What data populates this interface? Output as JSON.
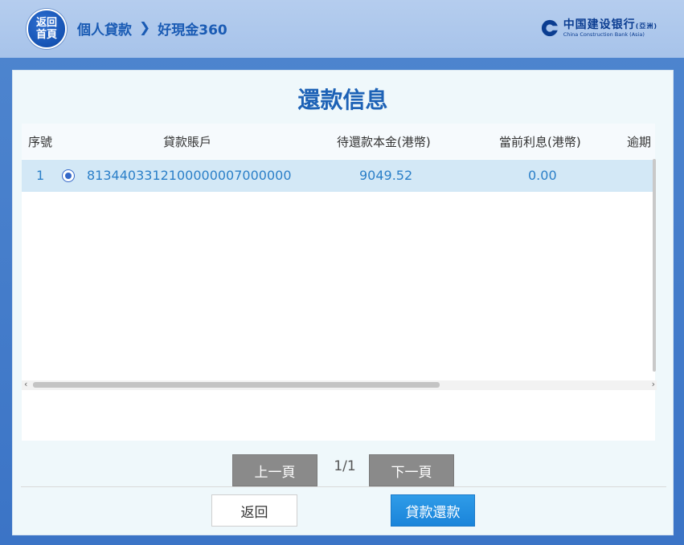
{
  "header": {
    "home_button_label": "返回首頁",
    "breadcrumb": [
      "個人貸款",
      "好現金360"
    ],
    "bank_name_cn": "中国建设银行",
    "bank_region_cn": "(亞洲)",
    "bank_name_en": "China Construction Bank (Asia)"
  },
  "panel": {
    "title": "還款信息",
    "table": {
      "columns": [
        "序號",
        "貸款賬戶",
        "待還款本金(港幣)",
        "當前利息(港幣)",
        "逾期"
      ],
      "rows": [
        {
          "index": "1",
          "selected": true,
          "account": "8134403312100000007000000",
          "principal": "9049.52",
          "interest": "0.00"
        }
      ]
    },
    "pager": {
      "prev_label": "上一頁",
      "page_indicator": "1/1",
      "next_label": "下一頁"
    },
    "actions": {
      "back_label": "返回",
      "repay_label": "貸款還款"
    }
  },
  "colors": {
    "header_bg": "#a9c4eb",
    "brand_blue": "#1a5bb4",
    "selected_row": "#d3e8f6",
    "primary_button": "#1f8ade",
    "pager_button": "#8a8a8a"
  },
  "icons": {
    "breadcrumb_separator": "chevron-right-icon",
    "bank_logo": "ccb-logo-icon",
    "scroll_left": "chevron-left-icon",
    "scroll_right": "chevron-right-icon"
  }
}
